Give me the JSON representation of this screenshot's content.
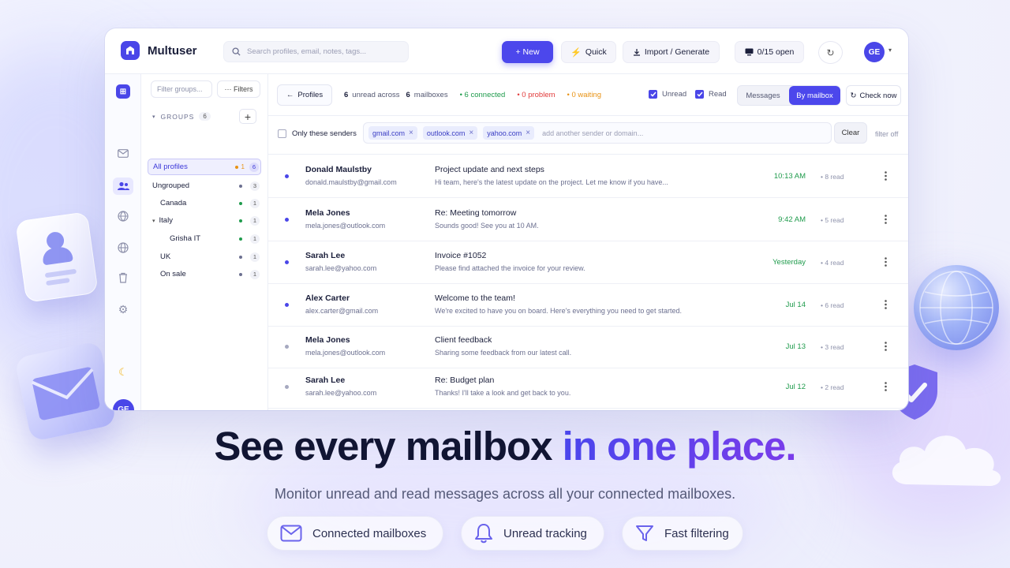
{
  "app": {
    "name": "Multuser",
    "search_placeholder": "Search profiles, email, notes, tags...",
    "new_label": "+ New",
    "quick_label": "Quick",
    "import_label": "Import / Generate",
    "open_label": "0/15 open",
    "avatar_initials": "GE",
    "accent_color": "#4c47ec"
  },
  "groups_panel": {
    "filter_placeholder": "Filter groups...",
    "filters_label": "··· Filters",
    "header_label": "GROUPS",
    "header_count": "6",
    "items": [
      {
        "label": "All profiles",
        "extra": "1",
        "count": "6",
        "dot": "#e89213",
        "active": true,
        "indent": 0
      },
      {
        "label": "Ungrouped",
        "count": "3",
        "dot": "#6c7090",
        "indent": 0
      },
      {
        "label": "Canada",
        "count": "1",
        "dot": "#1f9b4c",
        "indent": 1
      },
      {
        "label": "Italy",
        "count": "1",
        "dot": "#1f9b4c",
        "indent": 1,
        "expanded": true
      },
      {
        "label": "Grisha IT",
        "count": "1",
        "dot": "#1f9b4c",
        "indent": 2
      },
      {
        "label": "UK",
        "count": "1",
        "dot": "#6c7090",
        "indent": 1
      },
      {
        "label": "On sale",
        "count": "1",
        "dot": "#6c7090",
        "indent": 1
      }
    ]
  },
  "toolbar": {
    "profiles_label": "Profiles",
    "unread_count": "6",
    "unread_text": "unread across",
    "mailbox_count": "6",
    "mailbox_text": "mailboxes",
    "connected": "• 6 connected",
    "problem": "• 0 problem",
    "waiting": "• 0 waiting",
    "unread_label": "Unread",
    "read_label": "Read",
    "messages_label": "Messages",
    "by_mailbox_label": "By mailbox",
    "check_now_label": "Check now"
  },
  "filterbar": {
    "only_label": "Only these senders",
    "chips": [
      "gmail.com",
      "outlook.com",
      "yahoo.com"
    ],
    "input_placeholder": "add another sender or domain...",
    "clear_label": "Clear",
    "status": "filter off"
  },
  "messages": [
    {
      "name": "Donald Maulstby",
      "email": "donald.maulstby@gmail.com",
      "subject": "Project update and next steps",
      "preview": "Hi team, here's the latest update on the project. Let me know if you have...",
      "time": "10:13 AM",
      "read": "• 8 read",
      "unread": true
    },
    {
      "name": "Mela Jones",
      "email": "mela.jones@outlook.com",
      "subject": "Re: Meeting tomorrow",
      "preview": "Sounds good! See you at 10 AM.",
      "time": "9:42 AM",
      "read": "• 5 read",
      "unread": true
    },
    {
      "name": "Sarah Lee",
      "email": "sarah.lee@yahoo.com",
      "subject": "Invoice #1052",
      "preview": "Please find attached the invoice for your review.",
      "time": "Yesterday",
      "read": "• 4 read",
      "unread": true
    },
    {
      "name": "Alex Carter",
      "email": "alex.carter@gmail.com",
      "subject": "Welcome to the team!",
      "preview": "We're excited to have you on board. Here's everything you need to get started.",
      "time": "Jul 14",
      "read": "• 6 read",
      "unread": true
    },
    {
      "name": "Mela Jones",
      "email": "mela.jones@outlook.com",
      "subject": "Client feedback",
      "preview": "Sharing some feedback from our latest call.",
      "time": "Jul 13",
      "read": "• 3 read",
      "unread": false
    },
    {
      "name": "Sarah Lee",
      "email": "sarah.lee@yahoo.com",
      "subject": "Re: Budget plan",
      "preview": "Thanks! I'll take a look and get back to you.",
      "time": "Jul 12",
      "read": "• 2 read",
      "unread": false
    }
  ],
  "hero": {
    "headline_main": "See every mailbox ",
    "headline_accent": "in one place.",
    "subtitle": "Monitor unread and read messages across all your connected mailboxes.",
    "features": [
      {
        "label": "Connected mailboxes",
        "icon": "mail-icon"
      },
      {
        "label": "Unread tracking",
        "icon": "bell-icon"
      },
      {
        "label": "Fast filtering",
        "icon": "filter-icon"
      }
    ]
  }
}
